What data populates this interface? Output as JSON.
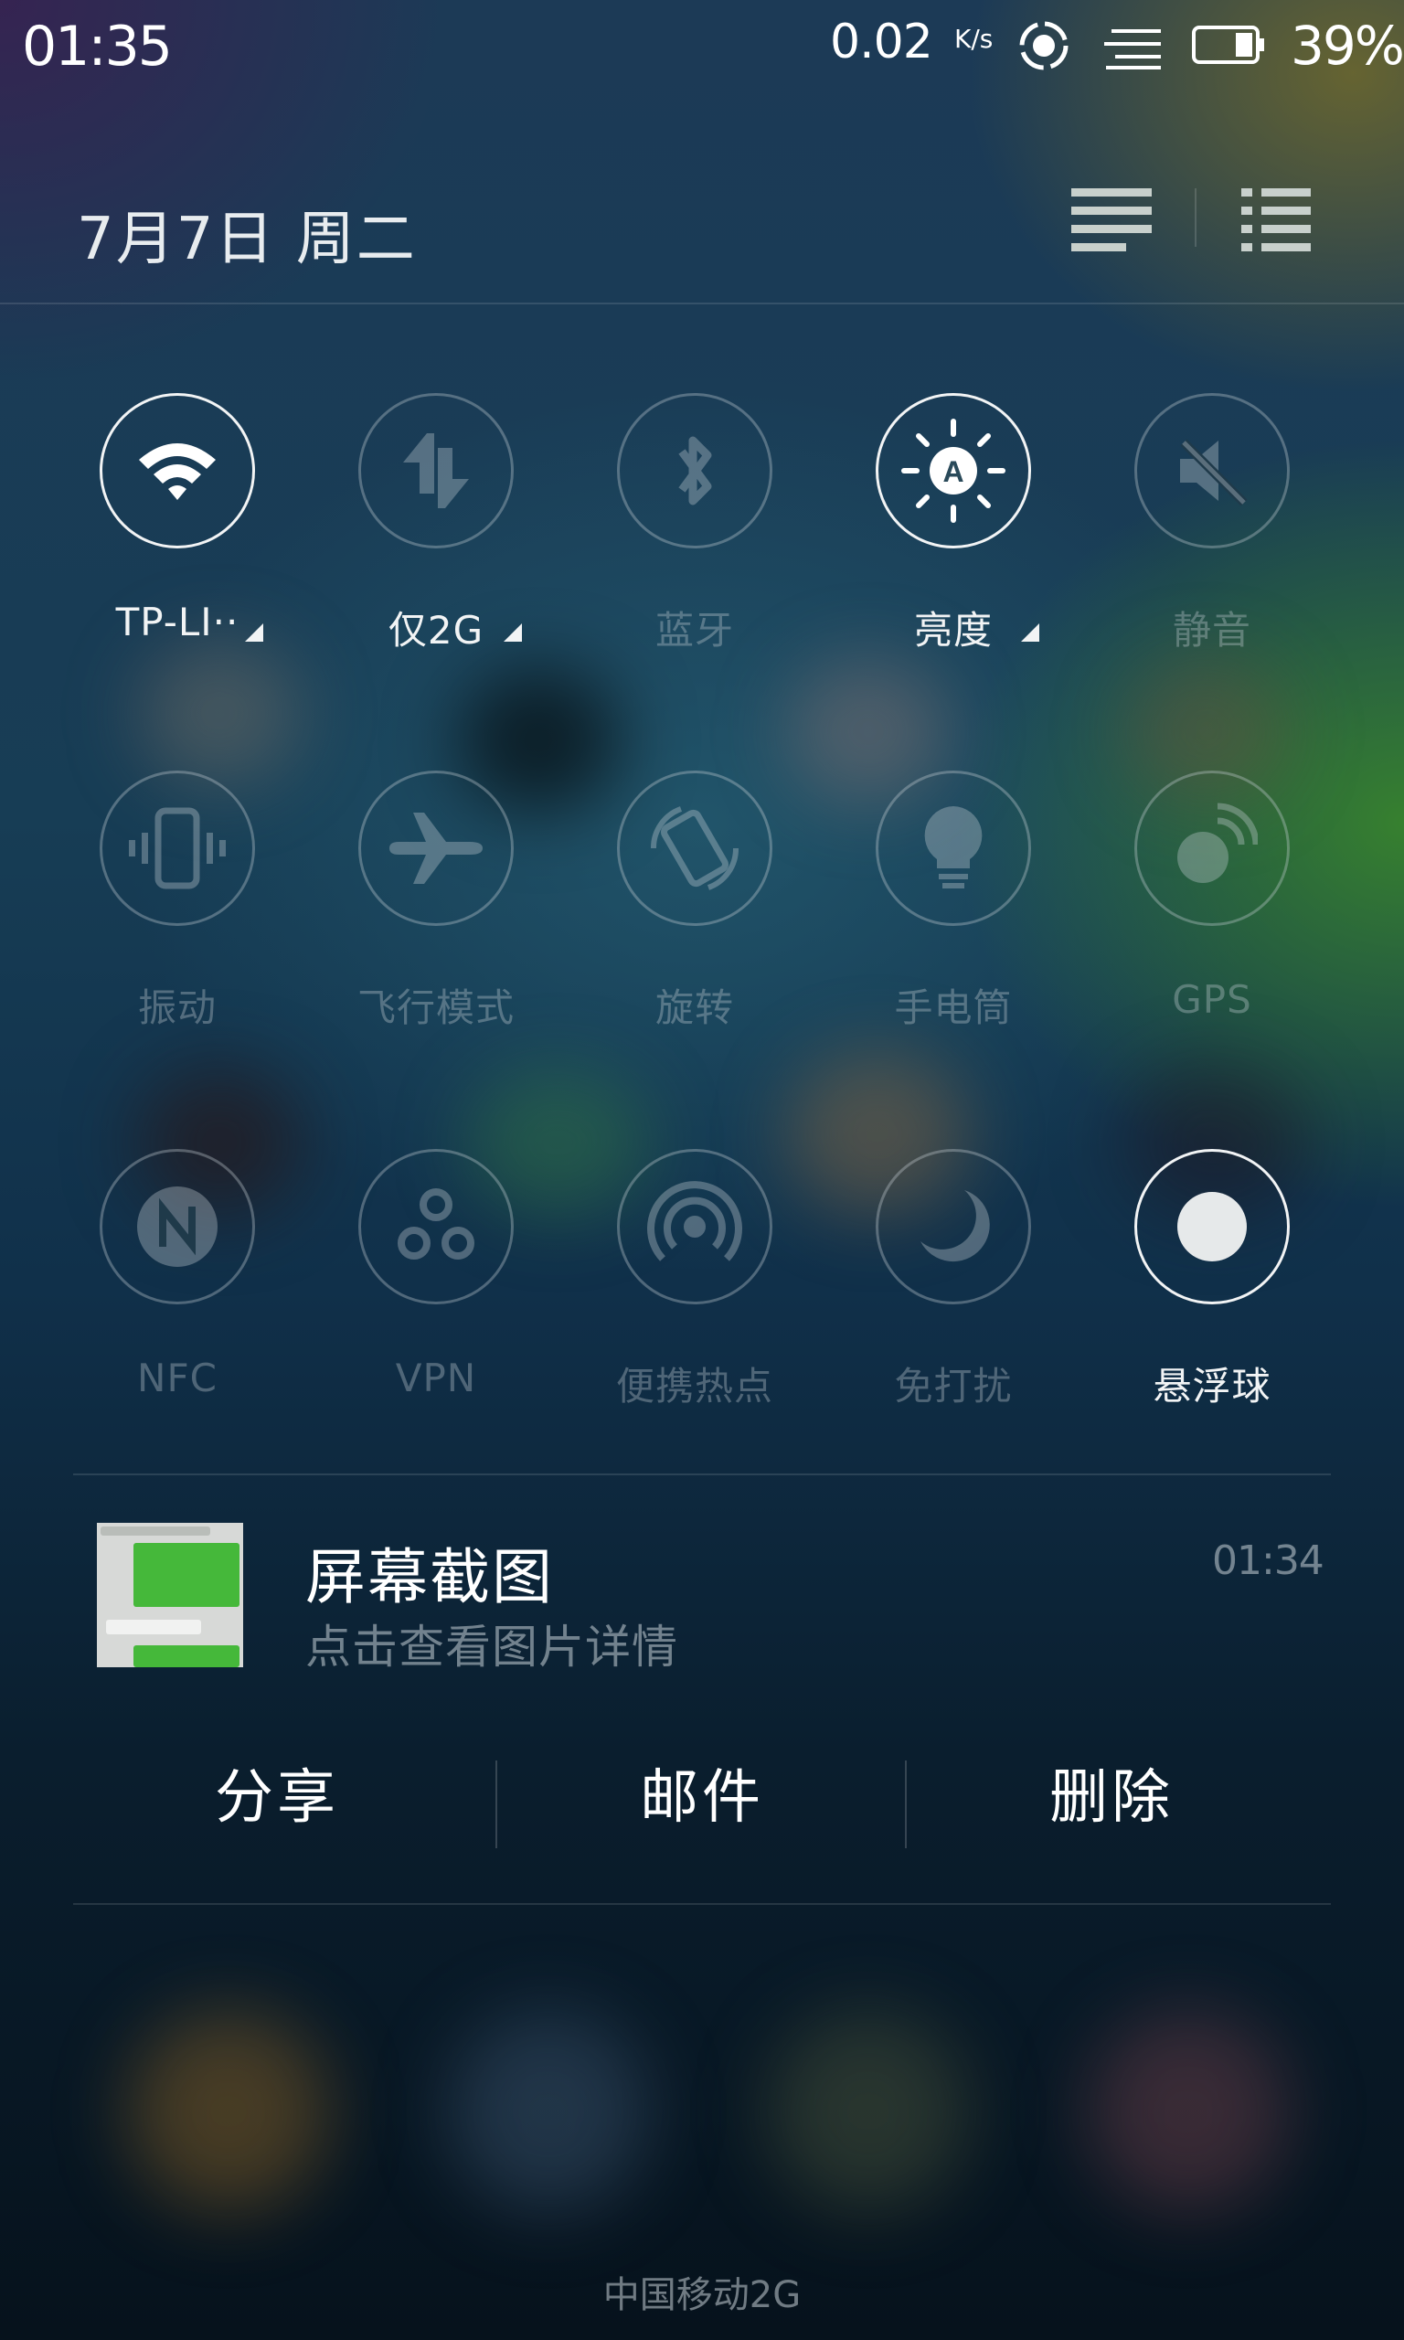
{
  "status_bar": {
    "time": "01:35",
    "net_speed": "0.02",
    "net_speed_unit": "K/s",
    "battery_percent": "39%",
    "icons": [
      "sync-icon",
      "signal-icon",
      "battery-icon"
    ]
  },
  "header": {
    "date": "7月7日  周二",
    "view_toggles": [
      "toggle-view-icon",
      "notification-list-icon"
    ]
  },
  "quick_toggles": [
    {
      "label": "TP-LI··",
      "icon": "wifi-icon",
      "active": true,
      "has_menu": true
    },
    {
      "label": "仅2G",
      "icon": "mobile-data-icon",
      "active": false,
      "has_menu": true
    },
    {
      "label": "蓝牙",
      "icon": "bluetooth-icon",
      "active": false,
      "has_menu": false
    },
    {
      "label": "亮度",
      "icon": "auto-brightness-icon",
      "active": true,
      "has_menu": true
    },
    {
      "label": "静音",
      "icon": "mute-icon",
      "active": false,
      "has_menu": false
    },
    {
      "label": "振动",
      "icon": "vibrate-icon",
      "active": false,
      "has_menu": false
    },
    {
      "label": "飞行模式",
      "icon": "airplane-icon",
      "active": false,
      "has_menu": false
    },
    {
      "label": "旋转",
      "icon": "rotate-icon",
      "active": false,
      "has_menu": false
    },
    {
      "label": "手电筒",
      "icon": "flashlight-icon",
      "active": false,
      "has_menu": false
    },
    {
      "label": "GPS",
      "icon": "gps-icon",
      "active": false,
      "has_menu": false
    },
    {
      "label": "NFC",
      "icon": "nfc-icon",
      "active": false,
      "has_menu": false
    },
    {
      "label": "VPN",
      "icon": "vpn-icon",
      "active": false,
      "has_menu": false
    },
    {
      "label": "便携热点",
      "icon": "hotspot-icon",
      "active": false,
      "has_menu": false
    },
    {
      "label": "免打扰",
      "icon": "do-not-disturb-icon",
      "active": false,
      "has_menu": false
    },
    {
      "label": "悬浮球",
      "icon": "floating-ball-icon",
      "active": true,
      "has_menu": false
    }
  ],
  "notification": {
    "title": "屏幕截图",
    "subtitle": "点击查看图片详情",
    "time": "01:34",
    "actions": [
      "分享",
      "邮件",
      "删除"
    ]
  },
  "carrier": "中国移动2G",
  "colors": {
    "active": "#f2f4f5",
    "inactive": "#c8d2d7",
    "divider": "#ffffff"
  }
}
